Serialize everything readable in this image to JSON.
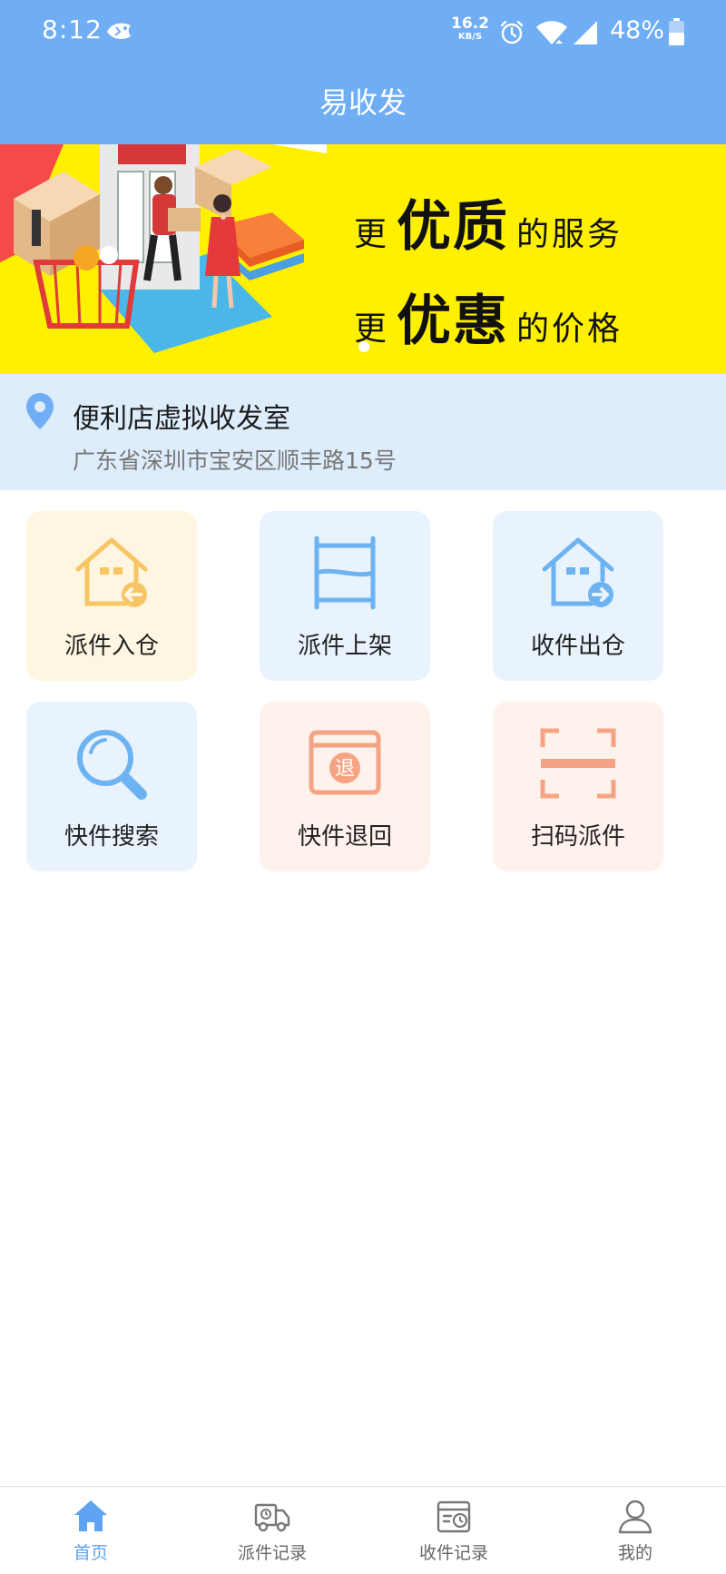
{
  "status_bar": {
    "time": "8:12",
    "net_speed_value": "16.2",
    "net_speed_unit": "KB/S",
    "battery": "48%",
    "icons": [
      "fish-icon",
      "alarm-icon",
      "wifi-icon",
      "signal-icon",
      "battery-icon"
    ]
  },
  "header": {
    "title": "易收发"
  },
  "banner": {
    "line1_prefix": "更",
    "line1_bold": "优质",
    "line1_suffix": "的服务",
    "line2_prefix": "更",
    "line2_bold": "优惠",
    "line2_suffix": "的价格",
    "background": "#fff000"
  },
  "location": {
    "name": "便利店虚拟收发室",
    "address": "广东省深圳市宝安区顺丰路15号",
    "pin_color": "#6fadf5"
  },
  "tiles": [
    {
      "label": "派件入仓",
      "icon": "house-in-icon",
      "color": "#f7c563"
    },
    {
      "label": "派件上架",
      "icon": "shelf-icon",
      "color": "#6db3f2"
    },
    {
      "label": "收件出仓",
      "icon": "house-out-icon",
      "color": "#6db3f2"
    },
    {
      "label": "快件搜索",
      "icon": "search-icon",
      "color": "#6db3f2"
    },
    {
      "label": "快件退回",
      "icon": "return-box-icon",
      "color": "#f4a483",
      "badge": "退"
    },
    {
      "label": "扫码派件",
      "icon": "scan-icon",
      "color": "#f4a483"
    }
  ],
  "bottom_nav": {
    "items": [
      {
        "label": "首页",
        "icon": "home-icon",
        "active": true
      },
      {
        "label": "派件记录",
        "icon": "truck-icon",
        "active": false
      },
      {
        "label": "收件记录",
        "icon": "receive-record-icon",
        "active": false
      },
      {
        "label": "我的",
        "icon": "user-icon",
        "active": false
      }
    ],
    "active_color": "#5ea4f2"
  },
  "colors": {
    "primary": "#6fadf5",
    "location_bg": "#deedfb"
  }
}
